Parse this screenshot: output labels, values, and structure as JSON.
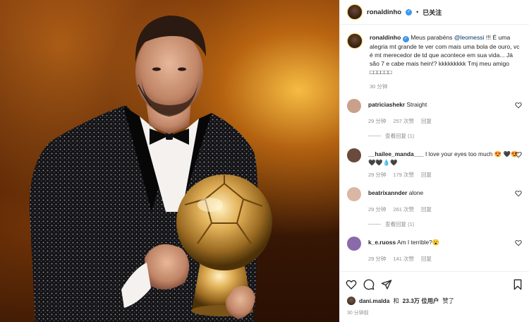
{
  "header": {
    "username": "ronaldinho",
    "separator": "•",
    "follow_label": "已关注"
  },
  "caption": {
    "username": "ronaldinho",
    "text_before_mention": "Meus parabéns ",
    "mention": "@leomessi",
    "text_after_mention": " !!! É uma alegria mt grande te ver com mais uma bola de ouro, vc é mt merecedor de td que acontece em sua vida... Já são 7 e cabe mais hein!? kkkkkkkkk Tmj meu amigo □□□□□□",
    "time": "30 分钟"
  },
  "comments": [
    {
      "username": "patriciashekr",
      "text": "Straight",
      "time": "29 分钟",
      "likes": "257 次赞",
      "reply": "回复",
      "view_replies": "查看回复 (1)",
      "avatar_color": "#c9a08a"
    },
    {
      "username": "__hailee_manda___",
      "text": "I love your eyes too much 😍 🖤😍🖤🖤💧🖤",
      "time": "29 分钟",
      "likes": "179 次赞",
      "reply": "回复",
      "view_replies": "",
      "avatar_color": "#6a4a3a"
    },
    {
      "username": "beatrixannder",
      "text": "alone",
      "time": "29 分钟",
      "likes": "261 次赞",
      "reply": "回复",
      "view_replies": "查看回复 (1)",
      "avatar_color": "#d9b7a4"
    },
    {
      "username": "k_e.ruoss",
      "text": "Am I terrible?😮",
      "time": "29 分钟",
      "likes": "141 次赞",
      "reply": "回复",
      "view_replies": "",
      "avatar_color": "#8a6aa8"
    }
  ],
  "likes": {
    "liker": "dani.malda",
    "joiner": "和",
    "count": "23.3万 位用户",
    "suffix": "赞了"
  },
  "post_time": "30 分钟前",
  "icons": {
    "like": "heart-icon",
    "comment": "comment-icon",
    "share": "share-icon",
    "save": "bookmark-icon",
    "verified": "verified-badge-icon"
  },
  "colors": {
    "verified": "#3897f0",
    "mention": "#00376b",
    "muted": "#8e8e8e",
    "divider": "#efefef"
  }
}
